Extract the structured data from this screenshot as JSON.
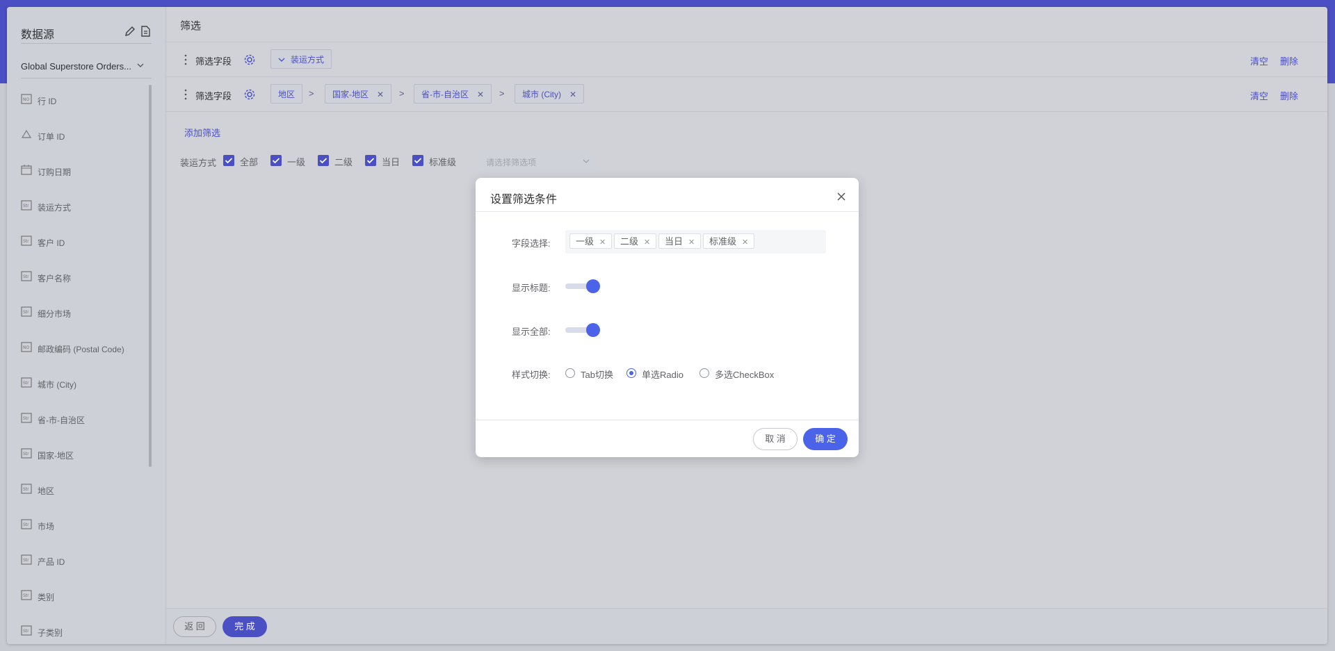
{
  "colors": {
    "accent": "#4b4fc4",
    "dialog_accent": "#4b63e8",
    "top_band": "#4b4fc4"
  },
  "sidebar": {
    "title": "数据源",
    "datasource": "Global Superstore Orders...",
    "fields": [
      {
        "label": "行 ID",
        "icon": "number-type-icon"
      },
      {
        "label": "订单 ID",
        "icon": "geo-type-icon"
      },
      {
        "label": "订购日期",
        "icon": "date-type-icon"
      },
      {
        "label": "装运方式",
        "icon": "string-type-icon"
      },
      {
        "label": "客户 ID",
        "icon": "string-type-icon"
      },
      {
        "label": "客户名称",
        "icon": "string-type-icon"
      },
      {
        "label": "细分市场",
        "icon": "string-type-icon"
      },
      {
        "label": "邮政编码 (Postal Code)",
        "icon": "number-type-icon"
      },
      {
        "label": "城市 (City)",
        "icon": "string-type-icon"
      },
      {
        "label": "省-市-自治区",
        "icon": "string-type-icon"
      },
      {
        "label": "国家-地区",
        "icon": "string-type-icon"
      },
      {
        "label": "地区",
        "icon": "string-type-icon"
      },
      {
        "label": "市场",
        "icon": "string-type-icon"
      },
      {
        "label": "产品 ID",
        "icon": "string-type-icon"
      },
      {
        "label": "类别",
        "icon": "string-type-icon"
      },
      {
        "label": "子类别",
        "icon": "string-type-icon"
      }
    ]
  },
  "main": {
    "title": "筛选",
    "rows": [
      {
        "label": "筛选字段",
        "chips": [
          "装运方式"
        ],
        "clear": "清空",
        "delete": "删除"
      },
      {
        "label": "筛选字段",
        "chips": [
          "地区",
          "国家-地区",
          "省-市-自治区",
          "城市 (City)"
        ],
        "clear": "清空",
        "delete": "删除"
      }
    ],
    "add_filter": "添加筛选",
    "preview": {
      "label": "装运方式",
      "options": [
        "全部",
        "一级",
        "二级",
        "当日",
        "标准级"
      ],
      "select_placeholder": "请选择筛选项"
    },
    "footer": {
      "back": "返 回",
      "done": "完 成"
    }
  },
  "dialog": {
    "title": "设置筛选条件",
    "field_label": "字段选择:",
    "tags": [
      "一级",
      "二级",
      "当日",
      "标准级"
    ],
    "show_title_label": "显示标题:",
    "show_title_on": true,
    "show_all_label": "显示全部:",
    "show_all_on": true,
    "style_label": "样式切换:",
    "style_options": [
      "Tab切换",
      "单选Radio",
      "多选CheckBox"
    ],
    "style_selected": "单选Radio",
    "cancel": "取 消",
    "ok": "确 定"
  }
}
